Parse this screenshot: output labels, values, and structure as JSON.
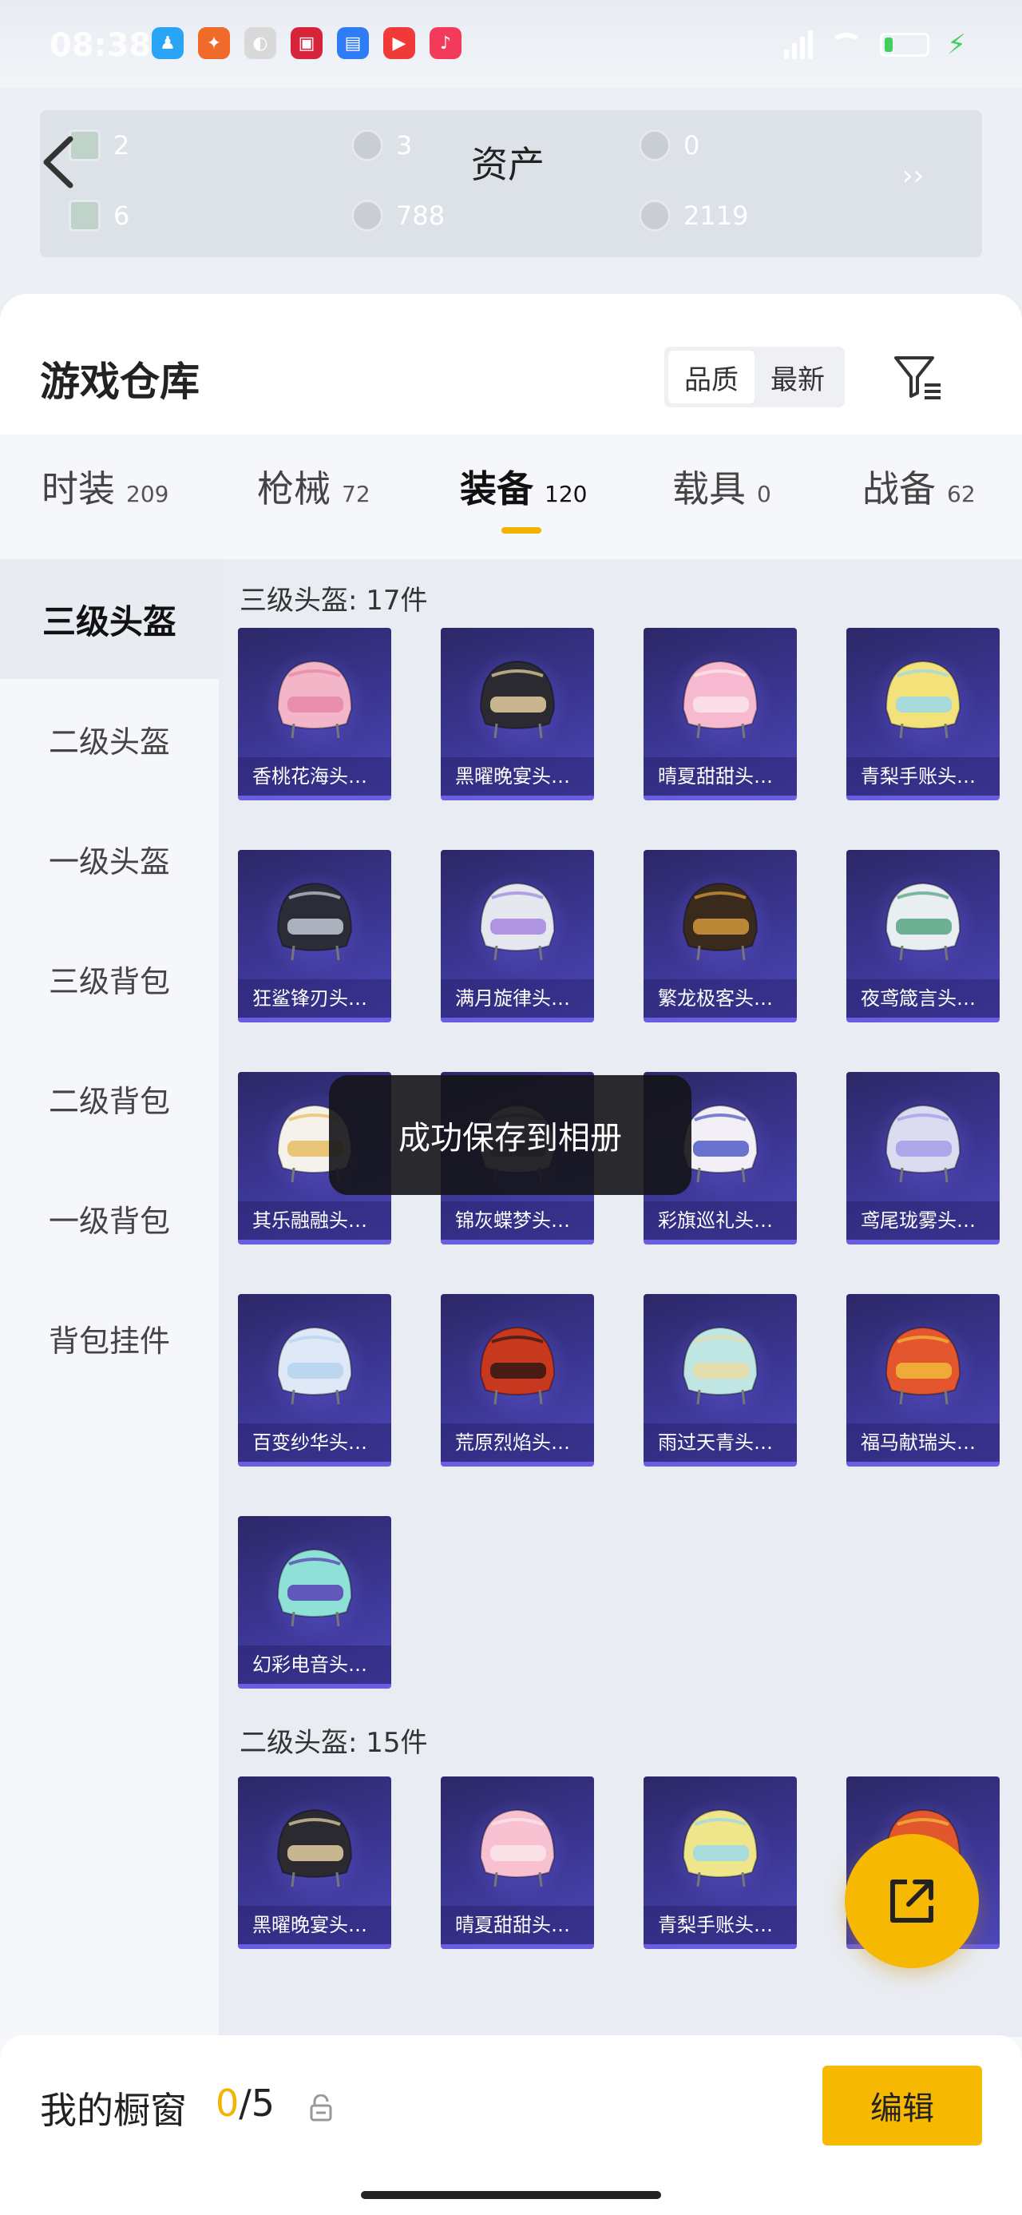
{
  "status_bar": {
    "time": "08:38",
    "icons": [
      "qq-icon",
      "game-icon",
      "photo-icon",
      "shopping-icon",
      "calendar-icon",
      "video-icon",
      "music-icon"
    ]
  },
  "assets": {
    "title": "资产",
    "values": [
      "2",
      "3",
      "0",
      "6",
      "788",
      "2119"
    ]
  },
  "warehouse": {
    "title": "游戏仓库",
    "sort": [
      "品质",
      "最新"
    ],
    "sort_active": 0
  },
  "tabs": [
    {
      "label": "时装",
      "count": "209"
    },
    {
      "label": "枪械",
      "count": "72"
    },
    {
      "label": "装备",
      "count": "120"
    },
    {
      "label": "载具",
      "count": "0"
    },
    {
      "label": "战备",
      "count": "62"
    }
  ],
  "active_tab": 2,
  "sidebar": [
    "三级头盔",
    "二级头盔",
    "一级头盔",
    "三级背包",
    "二级背包",
    "一级背包",
    "背包挂件"
  ],
  "sidebar_active": 0,
  "groups": [
    {
      "title": "三级头盔: 17件",
      "items": [
        {
          "name": "香桃花海头…",
          "color": "#f2b6c8",
          "accent": "#e88aa8"
        },
        {
          "name": "黑曜晚宴头…",
          "color": "#2a2a30",
          "accent": "#d8c59a"
        },
        {
          "name": "晴夏甜甜头…",
          "color": "#f7b9cf",
          "accent": "#fbe3ea"
        },
        {
          "name": "青梨手账头…",
          "color": "#f3e27a",
          "accent": "#9fd9e4"
        },
        {
          "name": "狂鲨锋刃头…",
          "color": "#2c2c36",
          "accent": "#b8c0cc"
        },
        {
          "name": "满月旋律头…",
          "color": "#e6e8f0",
          "accent": "#a88ce0"
        },
        {
          "name": "繁龙极客头…",
          "color": "#3a2a1c",
          "accent": "#c9923a"
        },
        {
          "name": "夜鸢箴言头…",
          "color": "#e9eef2",
          "accent": "#5fa98a"
        },
        {
          "name": "其乐融融头…",
          "color": "#f5f2ec",
          "accent": "#e8c06a"
        },
        {
          "name": "锦灰蝶梦头…",
          "color": "#c9c6d8",
          "accent": "#8a86a8"
        },
        {
          "name": "彩旗巡礼头…",
          "color": "#f2f0f6",
          "accent": "#5a64c8"
        },
        {
          "name": "鸢尾珑雾头…",
          "color": "#dcdcf0",
          "accent": "#a9a0e8"
        },
        {
          "name": "百变纱华头…",
          "color": "#dfe8f6",
          "accent": "#b8d4f0"
        },
        {
          "name": "荒原烈焰头…",
          "color": "#c8381e",
          "accent": "#3a1a14"
        },
        {
          "name": "雨过天青头…",
          "color": "#bfe6e2",
          "accent": "#e8dca8"
        },
        {
          "name": "福马献瑞头…",
          "color": "#e3562e",
          "accent": "#f0b43a"
        },
        {
          "name": "幻彩电音头…",
          "color": "#8fe0d6",
          "accent": "#5b4ab8"
        }
      ]
    },
    {
      "title": "二级头盔: 15件",
      "items": [
        {
          "name": "黑曜晚宴头…",
          "color": "#2a2a30",
          "accent": "#d8c59a"
        },
        {
          "name": "晴夏甜甜头…",
          "color": "#f7c1d2",
          "accent": "#fbe3ea"
        },
        {
          "name": "青梨手账头…",
          "color": "#efe58a",
          "accent": "#9fd9e4"
        },
        {
          "name": "",
          "color": "#e3562e",
          "accent": "#f0b43a"
        }
      ]
    }
  ],
  "toast": "成功保存到相册",
  "bottom": {
    "label": "我的橱窗",
    "count_used": "0",
    "count_sep": "/",
    "count_total": "5",
    "edit": "编辑"
  }
}
